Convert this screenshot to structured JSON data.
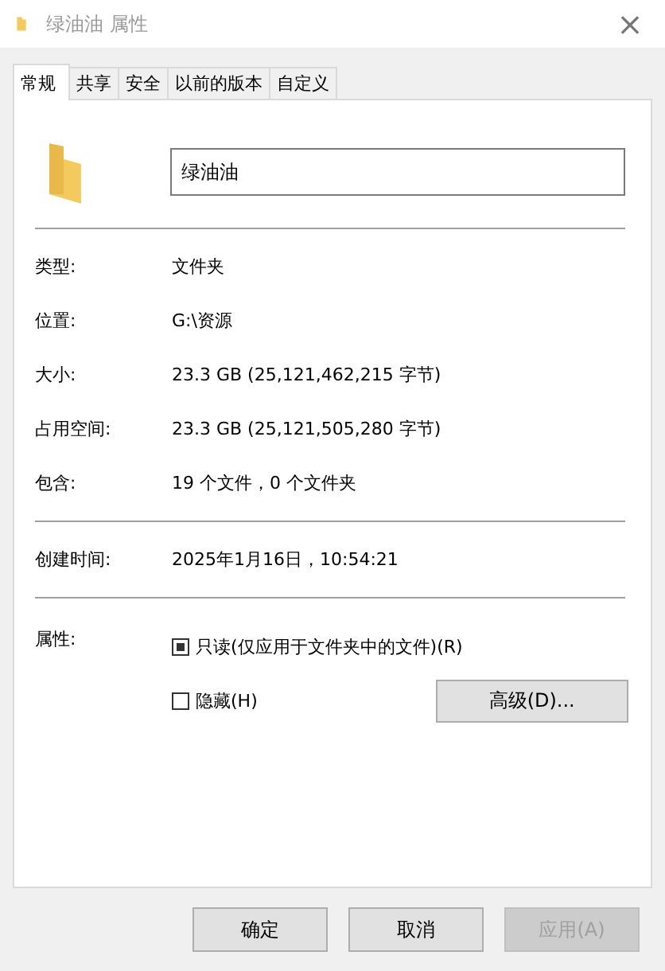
{
  "window": {
    "title": "绿油油 属性",
    "close": "×"
  },
  "tabs": [
    {
      "label": "常规",
      "selected": true
    },
    {
      "label": "共享",
      "selected": false
    },
    {
      "label": "安全",
      "selected": false
    },
    {
      "label": "以前的版本",
      "selected": false
    },
    {
      "label": "自定义",
      "selected": false
    }
  ],
  "name_field": {
    "value": "绿油油"
  },
  "groups": [
    [
      {
        "label": "类型:",
        "value": "文件夹"
      },
      {
        "label": "位置:",
        "value": "G:\\资源"
      },
      {
        "label": "大小:",
        "value": "23.3 GB (25,121,462,215 字节)"
      },
      {
        "label": "占用空间:",
        "value": "23.3 GB (25,121,505,280 字节)"
      },
      {
        "label": "包含:",
        "value": "19 个文件，0 个文件夹"
      }
    ],
    [
      {
        "label": "创建时间:",
        "value": "2025年1月16日，10:54:21"
      }
    ]
  ],
  "attributes": {
    "label": "属性:",
    "checkboxes": [
      {
        "label": "只读(仅应用于文件夹中的文件)(R)",
        "checked": true,
        "indeterminate": true
      },
      {
        "label": "隐藏(H)",
        "checked": false,
        "indeterminate": false
      }
    ],
    "advanced_button": "高级(D)..."
  },
  "buttons": [
    {
      "label": "确定",
      "disabled": false
    },
    {
      "label": "取消",
      "disabled": false
    },
    {
      "label": "应用(A)",
      "disabled": true
    }
  ]
}
